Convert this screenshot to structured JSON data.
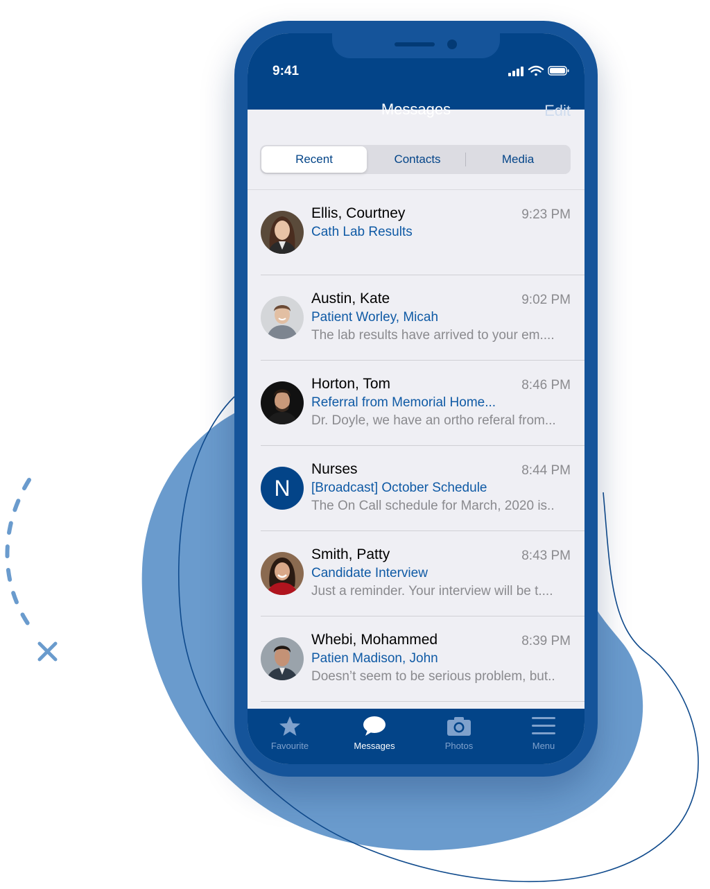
{
  "status_bar": {
    "time": "9:41"
  },
  "nav": {
    "title": "Messages",
    "edit": "Edit"
  },
  "segments": [
    "Recent",
    "Contacts",
    "Media"
  ],
  "selected_segment": "Recent",
  "messages": [
    {
      "name": "Ellis, Courtney",
      "time": "9:23 PM",
      "subject": "Cath Lab Results",
      "preview": ""
    },
    {
      "name": "Austin, Kate",
      "time": "9:02 PM",
      "subject": "Patient Worley, Micah",
      "preview": "The lab results have arrived to your em...."
    },
    {
      "name": "Horton, Tom",
      "time": "8:46 PM",
      "subject": "Referral from Memorial Home...",
      "preview": "Dr. Doyle, we have an ortho referal from..."
    },
    {
      "name": "Nurses",
      "time": "8:44 PM",
      "subject": "[Broadcast] October Schedule",
      "preview": "The On Call schedule for March, 2020 is..",
      "initial": "N"
    },
    {
      "name": "Smith, Patty",
      "time": "8:43 PM",
      "subject": "Candidate Interview",
      "preview": "Just a reminder. Your interview will be t...."
    },
    {
      "name": "Whebi, Mohammed",
      "time": "8:39 PM",
      "subject": "Patien Madison, John",
      "preview": "Doesn’t seem to be serious problem, but.."
    }
  ],
  "tabbar": {
    "items": [
      {
        "label": "Favourite",
        "icon": "star-icon"
      },
      {
        "label": "Messages",
        "icon": "speech-bubble-icon"
      },
      {
        "label": "Photos",
        "icon": "camera-icon"
      },
      {
        "label": "Menu",
        "icon": "hamburger-menu-icon"
      }
    ],
    "active": "Messages"
  },
  "colors": {
    "brand_navy": "#034488",
    "phone_frame": "#15549a",
    "subject_blue": "#0f5aa5",
    "blob_blue": "#6a9bcd",
    "list_background": "#efeff4"
  }
}
